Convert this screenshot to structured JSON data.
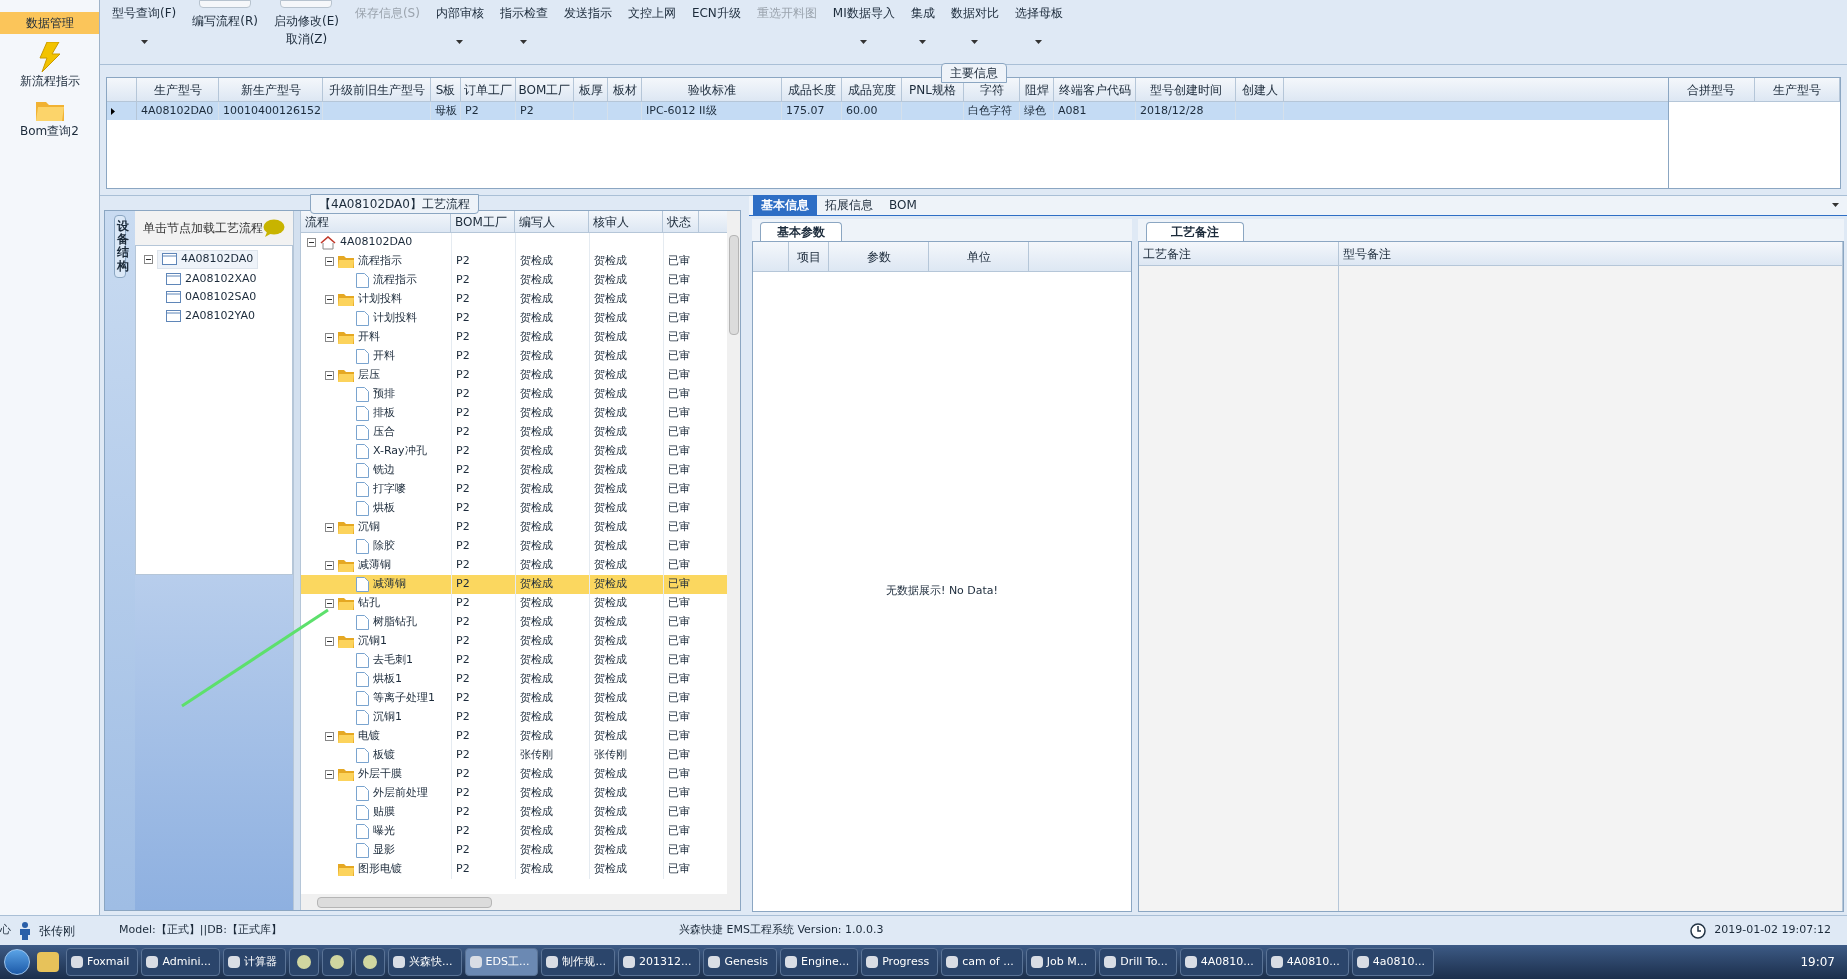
{
  "sidebar": {
    "items": [
      {
        "label": "数据管理",
        "selected": true
      },
      {
        "label": "新流程指示",
        "selected": false
      },
      {
        "label": "Bom查询2",
        "selected": false
      }
    ]
  },
  "toolbar": [
    {
      "kind": "menu",
      "label": "型号查询(F)",
      "disabled": false,
      "dropdown": true
    },
    {
      "kind": "toggle",
      "label": "编写流程(R)",
      "disabled": false,
      "on": false
    },
    {
      "kind": "toggle2",
      "label": "启动修改(E)",
      "label2": "取消(Z)",
      "disabled": false,
      "on": false
    },
    {
      "kind": "menu",
      "label": "保存信息(S)",
      "disabled": true,
      "dropdown": false
    },
    {
      "kind": "menu",
      "label": "内部审核",
      "disabled": false,
      "dropdown": true
    },
    {
      "kind": "menu",
      "label": "指示检查",
      "disabled": false,
      "dropdown": true
    },
    {
      "kind": "menu",
      "label": "发送指示",
      "disabled": false,
      "dropdown": false
    },
    {
      "kind": "menu",
      "label": "文控上网",
      "disabled": false,
      "dropdown": false
    },
    {
      "kind": "menu",
      "label": "ECN升级",
      "disabled": false,
      "dropdown": false
    },
    {
      "kind": "menu",
      "label": "重选开料图",
      "disabled": true,
      "dropdown": false
    },
    {
      "kind": "menu",
      "label": "MI数据导入",
      "disabled": false,
      "dropdown": true
    },
    {
      "kind": "menu",
      "label": "集成",
      "disabled": false,
      "dropdown": true
    },
    {
      "kind": "menu",
      "label": "数据对比",
      "disabled": false,
      "dropdown": true
    },
    {
      "kind": "menu",
      "label": "选择母板",
      "disabled": false,
      "dropdown": true
    }
  ],
  "main_info": {
    "title": "主要信息",
    "columns": [
      "生产型号",
      "新生产型号",
      "升级前旧生产型号",
      "S板",
      "订单工厂",
      "BOM工厂",
      "板厚",
      "板材",
      "验收标准",
      "成品长度",
      "成品宽度",
      "PNL规格",
      "字符",
      "阻焊",
      "终端客户代码",
      "型号创建时间",
      "创建人"
    ],
    "rows": [
      {
        "selected": true,
        "cells": [
          "4A08102DA0",
          "10010400126152",
          "",
          "母板",
          "P2",
          "P2",
          "",
          "",
          "IPC-6012 II级",
          "175.07",
          "60.00",
          "",
          "白色字符",
          "绿色",
          "A081",
          "2018/12/28",
          ""
        ]
      }
    ],
    "side_columns": [
      "合拼型号",
      "生产型号"
    ]
  },
  "process_panel": {
    "title": "【4A08102DA0】工艺流程",
    "side_tab": "设备结构",
    "hint": "单击节点加载工艺流程",
    "structure": {
      "label": "4A08102DA0",
      "children": [
        {
          "label": "2A08102XA0"
        },
        {
          "label": "0A08102SA0"
        },
        {
          "label": "2A08102YA0"
        }
      ]
    },
    "columns": [
      "流程",
      "BOM工厂",
      "编写人",
      "核审人",
      "状态"
    ],
    "tree": {
      "kind": "root",
      "label": "4A08102DA0",
      "children": [
        {
          "kind": "folder",
          "label": "流程指示",
          "bom": "P2",
          "writer": "贺检成",
          "reviewer": "贺检成",
          "status": "已审",
          "selected": false,
          "children": [
            {
              "kind": "step",
              "label": "流程指示",
              "bom": "P2",
              "writer": "贺检成",
              "reviewer": "贺检成",
              "status": "已审",
              "selected": false
            }
          ]
        },
        {
          "kind": "folder",
          "label": "计划投料",
          "bom": "P2",
          "writer": "贺检成",
          "reviewer": "贺检成",
          "status": "已审",
          "selected": false,
          "children": [
            {
              "kind": "step",
              "label": "计划投料",
              "bom": "P2",
              "writer": "贺检成",
              "reviewer": "贺检成",
              "status": "已审",
              "selected": false
            }
          ]
        },
        {
          "kind": "folder",
          "label": "开料",
          "bom": "P2",
          "writer": "贺检成",
          "reviewer": "贺检成",
          "status": "已审",
          "selected": false,
          "children": [
            {
              "kind": "step",
              "label": "开料",
              "bom": "P2",
              "writer": "贺检成",
              "reviewer": "贺检成",
              "status": "已审",
              "selected": false
            }
          ]
        },
        {
          "kind": "folder",
          "label": "层压",
          "bom": "P2",
          "writer": "贺检成",
          "reviewer": "贺检成",
          "status": "已审",
          "selected": false,
          "children": [
            {
              "kind": "step",
              "label": "预排",
              "bom": "P2",
              "writer": "贺检成",
              "reviewer": "贺检成",
              "status": "已审",
              "selected": false
            },
            {
              "kind": "step",
              "label": "排板",
              "bom": "P2",
              "writer": "贺检成",
              "reviewer": "贺检成",
              "status": "已审",
              "selected": false
            },
            {
              "kind": "step",
              "label": "压合",
              "bom": "P2",
              "writer": "贺检成",
              "reviewer": "贺检成",
              "status": "已审",
              "selected": false
            },
            {
              "kind": "step",
              "label": "X-Ray冲孔",
              "bom": "P2",
              "writer": "贺检成",
              "reviewer": "贺检成",
              "status": "已审",
              "selected": false
            },
            {
              "kind": "step",
              "label": "铣边",
              "bom": "P2",
              "writer": "贺检成",
              "reviewer": "贺检成",
              "status": "已审",
              "selected": false
            },
            {
              "kind": "step",
              "label": "打字嘜",
              "bom": "P2",
              "writer": "贺检成",
              "reviewer": "贺检成",
              "status": "已审",
              "selected": false
            },
            {
              "kind": "step",
              "label": "烘板",
              "bom": "P2",
              "writer": "贺检成",
              "reviewer": "贺检成",
              "status": "已审",
              "selected": false
            }
          ]
        },
        {
          "kind": "folder",
          "label": "沉铜",
          "bom": "P2",
          "writer": "贺检成",
          "reviewer": "贺检成",
          "status": "已审",
          "selected": false,
          "children": [
            {
              "kind": "step",
              "label": "除胶",
              "bom": "P2",
              "writer": "贺检成",
              "reviewer": "贺检成",
              "status": "已审",
              "selected": false
            }
          ]
        },
        {
          "kind": "folder",
          "label": "减薄铜",
          "bom": "P2",
          "writer": "贺检成",
          "reviewer": "贺检成",
          "status": "已审",
          "selected": false,
          "children": [
            {
              "kind": "step",
              "label": "减薄铜",
              "bom": "P2",
              "writer": "贺检成",
              "reviewer": "贺检成",
              "status": "已审",
              "selected": true
            }
          ]
        },
        {
          "kind": "folder",
          "label": "钻孔",
          "bom": "P2",
          "writer": "贺检成",
          "reviewer": "贺检成",
          "status": "已审",
          "selected": false,
          "children": [
            {
              "kind": "step",
              "label": "树脂钻孔",
              "bom": "P2",
              "writer": "贺检成",
              "reviewer": "贺检成",
              "status": "已审",
              "selected": false
            }
          ]
        },
        {
          "kind": "folder",
          "label": "沉铜1",
          "bom": "P2",
          "writer": "贺检成",
          "reviewer": "贺检成",
          "status": "已审",
          "selected": false,
          "children": [
            {
              "kind": "step",
              "label": "去毛刺1",
              "bom": "P2",
              "writer": "贺检成",
              "reviewer": "贺检成",
              "status": "已审",
              "selected": false
            },
            {
              "kind": "step",
              "label": "烘板1",
              "bom": "P2",
              "writer": "贺检成",
              "reviewer": "贺检成",
              "status": "已审",
              "selected": false
            },
            {
              "kind": "step",
              "label": "等离子处理1",
              "bom": "P2",
              "writer": "贺检成",
              "reviewer": "贺检成",
              "status": "已审",
              "selected": false
            },
            {
              "kind": "step",
              "label": "沉铜1",
              "bom": "P2",
              "writer": "贺检成",
              "reviewer": "贺检成",
              "status": "已审",
              "selected": false
            }
          ]
        },
        {
          "kind": "folder",
          "label": "电镀",
          "bom": "P2",
          "writer": "贺检成",
          "reviewer": "贺检成",
          "status": "已审",
          "selected": false,
          "children": [
            {
              "kind": "step",
              "label": "板镀",
              "bom": "P2",
              "writer": "张传刚",
              "reviewer": "张传刚",
              "status": "已审",
              "selected": false
            }
          ]
        },
        {
          "kind": "folder",
          "label": "外层干膜",
          "bom": "P2",
          "writer": "贺检成",
          "reviewer": "贺检成",
          "status": "已审",
          "selected": false,
          "children": [
            {
              "kind": "step",
              "label": "外层前处理",
              "bom": "P2",
              "writer": "贺检成",
              "reviewer": "贺检成",
              "status": "已审",
              "selected": false
            },
            {
              "kind": "step",
              "label": "贴膜",
              "bom": "P2",
              "writer": "贺检成",
              "reviewer": "贺检成",
              "status": "已审",
              "selected": false
            },
            {
              "kind": "step",
              "label": "曝光",
              "bom": "P2",
              "writer": "贺检成",
              "reviewer": "贺检成",
              "status": "已审",
              "selected": false
            },
            {
              "kind": "step",
              "label": "显影",
              "bom": "P2",
              "writer": "贺检成",
              "reviewer": "贺检成",
              "status": "已审",
              "selected": false
            }
          ]
        },
        {
          "kind": "folder",
          "label": "图形电镀",
          "bom": "P2",
          "writer": "贺检成",
          "reviewer": "贺检成",
          "status": "已审",
          "selected": false
        }
      ]
    }
  },
  "detail_panel": {
    "tabs": [
      {
        "label": "基本信息",
        "selected": true
      },
      {
        "label": "拓展信息",
        "selected": false
      },
      {
        "label": "BOM",
        "selected": false
      }
    ],
    "params": {
      "tab": "基本参数",
      "columns": [
        "项目",
        "参数",
        "单位"
      ],
      "empty_text": "无数据展示! No Data!"
    },
    "notes": {
      "tab": "工艺备注",
      "columns": [
        "工艺备注",
        "型号备注"
      ]
    }
  },
  "status_bar": {
    "edge_text": "心",
    "user": "张传刚",
    "model": "Model:【正式】||DB:【正式库】",
    "system": "兴森快捷 EMS工程系统 Version: 1.0.0.3",
    "datetime": "2019-01-02 19:07:12"
  },
  "taskbar": {
    "items": [
      {
        "label": "Foxmail",
        "selected": false
      },
      {
        "label": "Admini...",
        "selected": false
      },
      {
        "label": "计算器",
        "selected": false
      },
      {
        "kind": "icon",
        "selected": false
      },
      {
        "kind": "icon",
        "selected": false
      },
      {
        "kind": "icon",
        "selected": false
      },
      {
        "label": "兴森快...",
        "selected": false
      },
      {
        "label": "EDS工...",
        "selected": true
      },
      {
        "label": "制作规...",
        "selected": false
      },
      {
        "label": "201312...",
        "selected": false
      },
      {
        "label": "Genesis",
        "selected": false
      },
      {
        "label": "Engine...",
        "selected": false
      },
      {
        "label": "Progress",
        "selected": false
      },
      {
        "label": "cam of ...",
        "selected": false
      },
      {
        "label": "Job M...",
        "selected": false
      },
      {
        "label": "Drill To...",
        "selected": false
      },
      {
        "label": "4A0810...",
        "selected": false
      },
      {
        "label": "4A0810...",
        "selected": false
      },
      {
        "label": "4a0810...",
        "selected": false
      }
    ],
    "clock": "19:07"
  }
}
